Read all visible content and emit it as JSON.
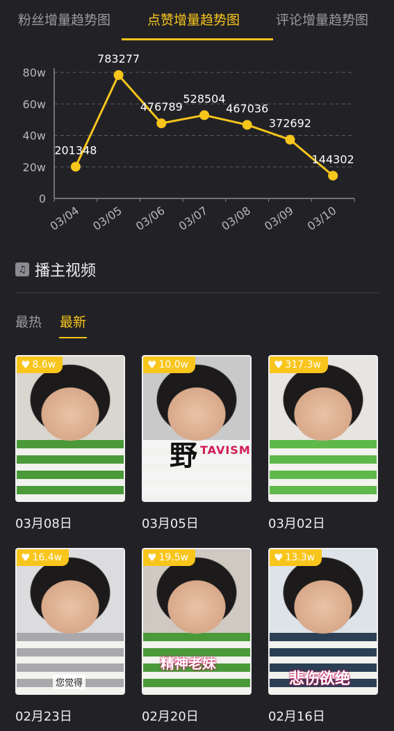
{
  "tabs": [
    {
      "label": "粉丝增量趋势图",
      "active": false
    },
    {
      "label": "点赞增量趋势图",
      "active": true
    },
    {
      "label": "评论增量趋势图",
      "active": false
    }
  ],
  "accent_color": "#f8c51c",
  "chart_data": {
    "type": "line",
    "x": [
      "03/04",
      "03/05",
      "03/06",
      "03/07",
      "03/08",
      "03/09",
      "03/10"
    ],
    "values": [
      201348,
      783277,
      476789,
      528504,
      467036,
      372692,
      144302
    ],
    "y_ticks": [
      "0",
      "20w",
      "40w",
      "60w",
      "80w"
    ],
    "ylim": [
      0,
      800000
    ],
    "grid": true,
    "color": "#f8c51c"
  },
  "section": {
    "title": "播主视频",
    "icon": "music-note-icon"
  },
  "subtabs": [
    {
      "label": "最热",
      "active": false
    },
    {
      "label": "最新",
      "active": true
    }
  ],
  "videos": [
    {
      "likes": "8.6w",
      "date": "03月08日",
      "palette": [
        "#d9d6d0",
        "#4a9a3a"
      ],
      "caption": ""
    },
    {
      "likes": "10.0w",
      "date": "03月05日",
      "palette": [
        "#c9c9c9",
        "#f5f5f5"
      ],
      "caption": "",
      "overlay_char": "野",
      "shirt_text": "TAVISM"
    },
    {
      "likes": "317.3w",
      "date": "03月02日",
      "palette": [
        "#e7e5e2",
        "#5fb84a"
      ],
      "caption": ""
    },
    {
      "likes": "16.4w",
      "date": "02月23日",
      "palette": [
        "#dcdcde",
        "#a9a9ad"
      ],
      "caption": "您觉得"
    },
    {
      "likes": "19.5w",
      "date": "02月20日",
      "palette": [
        "#cfc9c2",
        "#4a9a3a"
      ],
      "caption": "精神老妹"
    },
    {
      "likes": "13.3w",
      "date": "02月16日",
      "palette": [
        "#dde3e8",
        "#2b3f55"
      ],
      "caption": "悲伤欲绝"
    }
  ]
}
